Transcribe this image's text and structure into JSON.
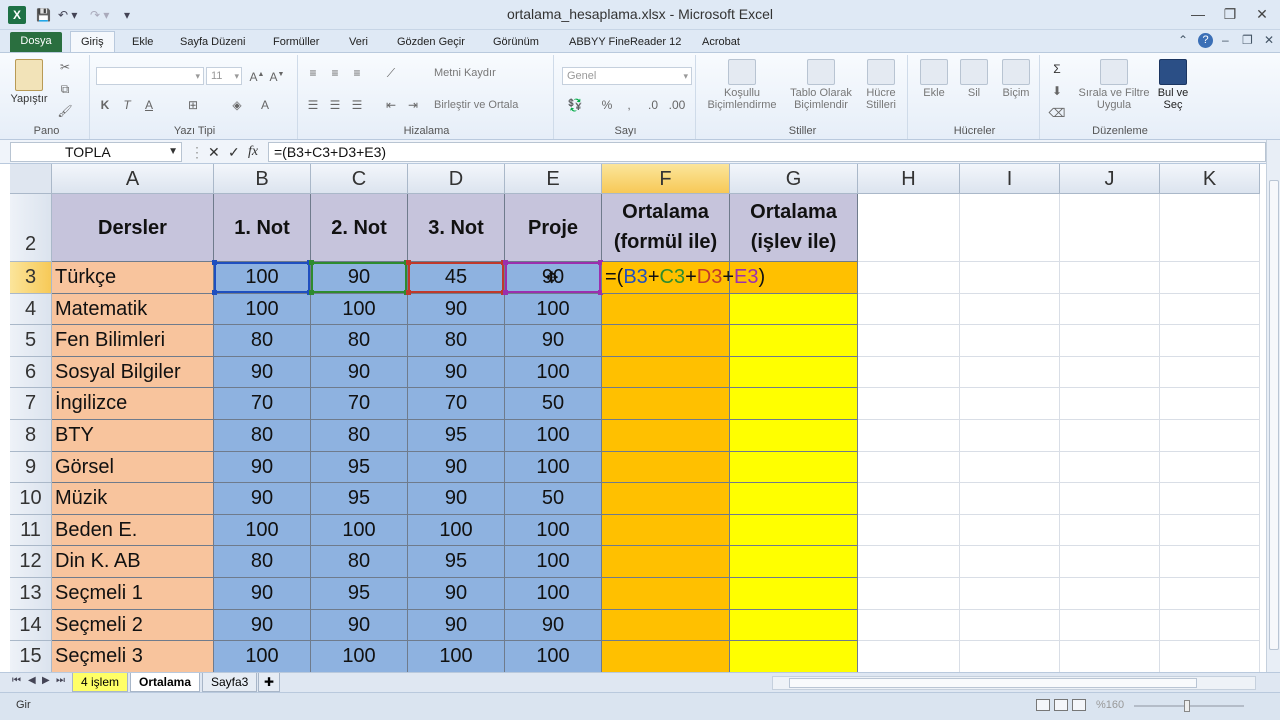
{
  "window": {
    "title": "ortalama_hesaplama.xlsx - Microsoft Excel",
    "app_icon": "X",
    "controls": {
      "minimize": "—",
      "restore": "❐",
      "close": "✕"
    }
  },
  "ribbon_tabs": [
    "Dosya",
    "Giriş",
    "Ekle",
    "Sayfa Düzeni",
    "Formüller",
    "Veri",
    "Gözden Geçir",
    "Görünüm",
    "ABBYY FineReader 12",
    "Acrobat"
  ],
  "ribbon": {
    "pano": {
      "label": "Pano",
      "paste": "Yapıştır"
    },
    "yazi_tipi": {
      "label": "Yazı Tipi",
      "font_size": "11",
      "bold": "K",
      "italic": "T",
      "underline": "A"
    },
    "hizalama": {
      "label": "Hizalama",
      "wrap": "Metni Kaydır",
      "merge": "Birleştir ve Ortala"
    },
    "sayi": {
      "label": "Sayı",
      "format": "Genel",
      "percent": "%"
    },
    "stiller": {
      "label": "Stiller",
      "conditional_1": "Koşullu",
      "conditional_2": "Biçimlendirme",
      "table_1": "Tablo Olarak",
      "table_2": "Biçimlendir",
      "cell_1": "Hücre",
      "cell_2": "Stilleri"
    },
    "hucreler": {
      "label": "Hücreler",
      "insert": "Ekle",
      "delete": "Sil",
      "format": "Biçim"
    },
    "duzenleme": {
      "label": "Düzenleme",
      "sort_1": "Sırala ve Filtre",
      "sort_2": "Uygula",
      "find_1": "Bul ve",
      "find_2": "Seç"
    }
  },
  "formula_bar": {
    "name_box": "TOPLA",
    "cancel": "✕",
    "enter": "✓",
    "fx": "fx",
    "formula": "=(B3+C3+D3+E3)"
  },
  "columns": [
    "A",
    "B",
    "C",
    "D",
    "E",
    "F",
    "G",
    "H",
    "I",
    "J",
    "K"
  ],
  "header_row": {
    "row": "2",
    "A": "Dersler",
    "B": "1. Not",
    "C": "2. Not",
    "D": "3. Not",
    "E": "Proje",
    "F_1": "Ortalama",
    "F_2": "(formül ile)",
    "G_1": "Ortalama",
    "G_2": "(işlev ile)"
  },
  "rows": [
    {
      "row": "3",
      "A": "Türkçe",
      "B": "100",
      "C": "90",
      "D": "45",
      "E": "90"
    },
    {
      "row": "4",
      "A": "Matematik",
      "B": "100",
      "C": "100",
      "D": "90",
      "E": "100"
    },
    {
      "row": "5",
      "A": "Fen Bilimleri",
      "B": "80",
      "C": "80",
      "D": "80",
      "E": "90"
    },
    {
      "row": "6",
      "A": "Sosyal Bilgiler",
      "B": "90",
      "C": "90",
      "D": "90",
      "E": "100"
    },
    {
      "row": "7",
      "A": "İngilizce",
      "B": "70",
      "C": "70",
      "D": "70",
      "E": "50"
    },
    {
      "row": "8",
      "A": "BTY",
      "B": "80",
      "C": "80",
      "D": "95",
      "E": "100"
    },
    {
      "row": "9",
      "A": "Görsel",
      "B": "90",
      "C": "95",
      "D": "90",
      "E": "100"
    },
    {
      "row": "10",
      "A": "Müzik",
      "B": "90",
      "C": "95",
      "D": "90",
      "E": "50"
    },
    {
      "row": "11",
      "A": "Beden E.",
      "B": "100",
      "C": "100",
      "D": "100",
      "E": "100"
    },
    {
      "row": "12",
      "A": "Din K. AB",
      "B": "80",
      "C": "80",
      "D": "95",
      "E": "100"
    },
    {
      "row": "13",
      "A": "Seçmeli 1",
      "B": "90",
      "C": "95",
      "D": "90",
      "E": "100"
    },
    {
      "row": "14",
      "A": "Seçmeli 2",
      "B": "90",
      "C": "90",
      "D": "90",
      "E": "90"
    },
    {
      "row": "15",
      "A": "Seçmeli 3",
      "B": "100",
      "C": "100",
      "D": "100",
      "E": "100"
    }
  ],
  "editing_cell": {
    "address": "F3",
    "parts": [
      "=(",
      "B3",
      "+",
      "C3",
      "+",
      "D3",
      "+",
      "E3",
      ")"
    ]
  },
  "colors": {
    "ref_b": "#1f4fbf",
    "ref_c": "#2e8b2e",
    "ref_d": "#c0392b",
    "ref_e": "#9b2fae",
    "excel_green": "#1e7145"
  },
  "sheet_tabs": [
    {
      "label": "4 işlem",
      "state": "colored"
    },
    {
      "label": "Ortalama",
      "state": "active"
    },
    {
      "label": "Sayfa3",
      "state": "normal"
    }
  ],
  "status": {
    "mode": "Gir",
    "zoom": "%160"
  }
}
